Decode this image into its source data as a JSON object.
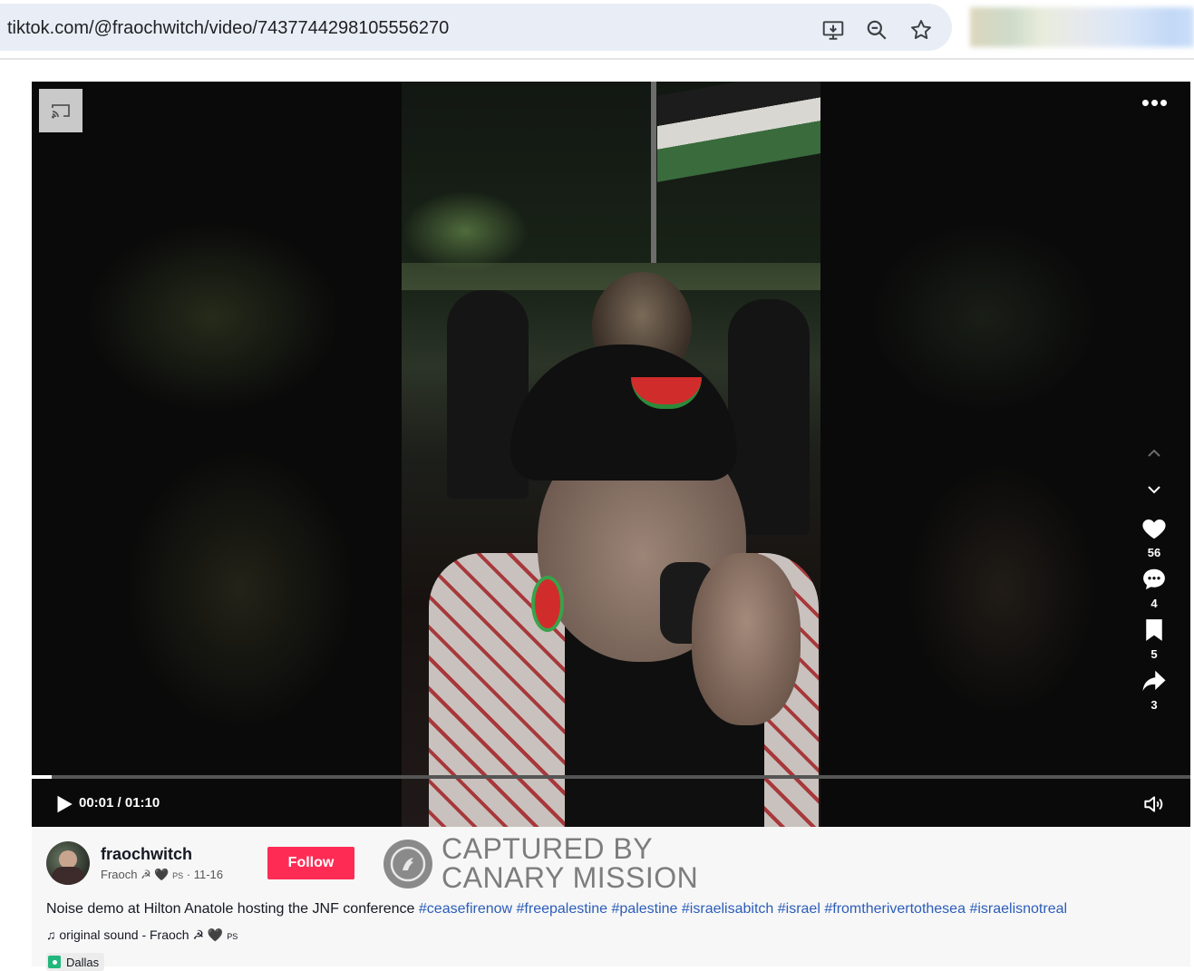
{
  "browser": {
    "url": "tiktok.com/@fraochwitch/video/7437744298105556270",
    "icons": [
      "install-app-icon",
      "zoom-icon",
      "bookmark-star-icon"
    ]
  },
  "player": {
    "time": "00:01 / 01:10",
    "progress": 0.017,
    "actions": {
      "likes": "56",
      "comments": "4",
      "saves": "5",
      "shares": "3"
    }
  },
  "post": {
    "username": "fraochwitch",
    "display_name": "Fraoch ☭ 🖤",
    "display_name_suffix": "PS",
    "date_sep": " · ",
    "date": "11-16",
    "follow_label": "Follow",
    "description": "Noise demo at Hilton Anatole hosting the JNF conference",
    "hashtags": [
      "#ceasefirenow",
      "#freepalestine",
      "#palestine",
      "#israelisabitch",
      "#israel",
      "#fromtherivertothesea",
      "#israelisnotreal"
    ],
    "sound": "original sound - Fraoch ☭ 🖤",
    "sound_suffix": "PS",
    "location": "Dallas"
  },
  "watermark": {
    "line1": "CAPTURED BY",
    "line2": "CANARY MISSION"
  },
  "colors": {
    "follow": "#fe2c55",
    "hashtag": "#2b5db9",
    "location_icon": "#21b77d"
  }
}
